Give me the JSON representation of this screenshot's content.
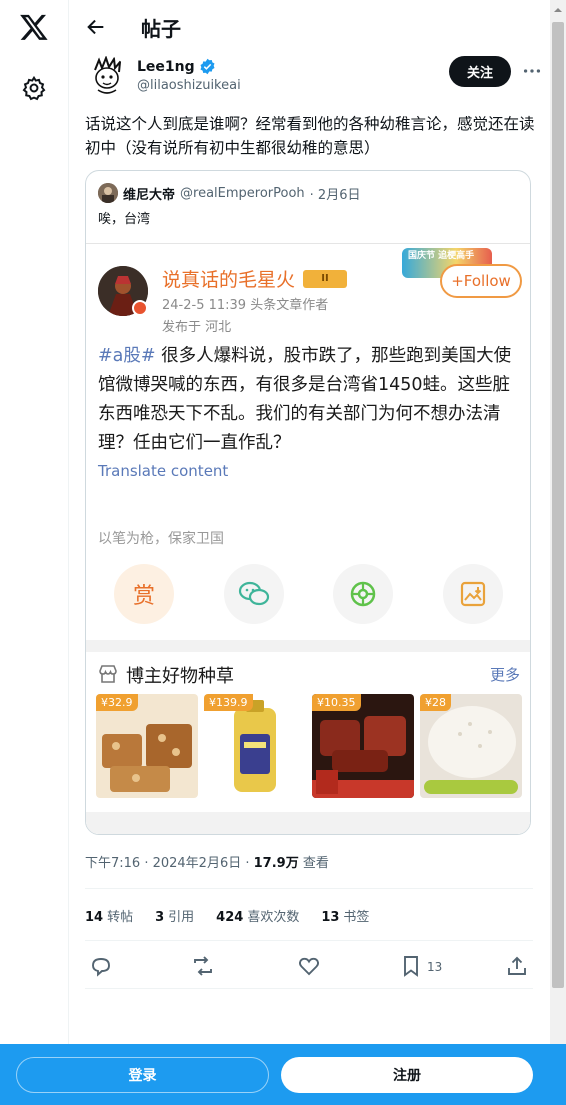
{
  "header": {
    "title": "帖子"
  },
  "post": {
    "author_name": "Lee1ng",
    "author_handle": "@lilaoshizuikeai",
    "follow_label": "关注",
    "text": "话说这个人到底是谁啊？经常看到他的各种幼稚言论，感觉还在读初中（没有说所有初中生都很幼稚的意思）",
    "timestamp": "下午7:16 · 2024年2月6日 ·",
    "views_count": "17.9万",
    "views_label": "查看"
  },
  "quote": {
    "name": "维尼大帝",
    "handle": "@realEmperorPooh",
    "date": "· 2月6日",
    "text": "唉，台湾",
    "screenshot": {
      "author": "说真话的毛星火",
      "level_badge": "II",
      "meta_line1": "24-2-5 11:39  头条文章作者",
      "meta_line2": "发布于 河北",
      "follow": "+Follow",
      "promo": "国庆节 追梗高手",
      "hashtag": "#a股#",
      "body": " 很多人爆料说，股市跌了，那些跑到美国大使馆微博哭喊的东西，有很多是台湾省1450蛙。这些脏东西唯恐天下不乱。我们的有关部门为何不想办法清理？任由它们一直作乱？",
      "translate": "Translate content",
      "slogan": "以笔为枪，保家卫国",
      "reward": "赏",
      "shop_title": "博主好物种草",
      "shop_more": "更多",
      "products": [
        {
          "price": "¥32.9",
          "color": "#b9783a"
        },
        {
          "price": "¥139.9",
          "color": "#e9c84a"
        },
        {
          "price": "¥10.35",
          "color": "#8a2a1c"
        },
        {
          "price": "¥28",
          "color": "#e9e3da"
        }
      ]
    }
  },
  "stats": [
    {
      "count": "14",
      "label": "转帖"
    },
    {
      "count": "3",
      "label": "引用"
    },
    {
      "count": "424",
      "label": "喜欢次数"
    },
    {
      "count": "13",
      "label": "书签"
    }
  ],
  "actions": {
    "bookmark_count": "13"
  },
  "bottom": {
    "login": "登录",
    "signup": "注册"
  },
  "colors": {
    "accent": "#1d9bf0",
    "verified": "#1d9bf0",
    "weibo_orange": "#e8702a",
    "weibo_link": "#5a79b8"
  }
}
